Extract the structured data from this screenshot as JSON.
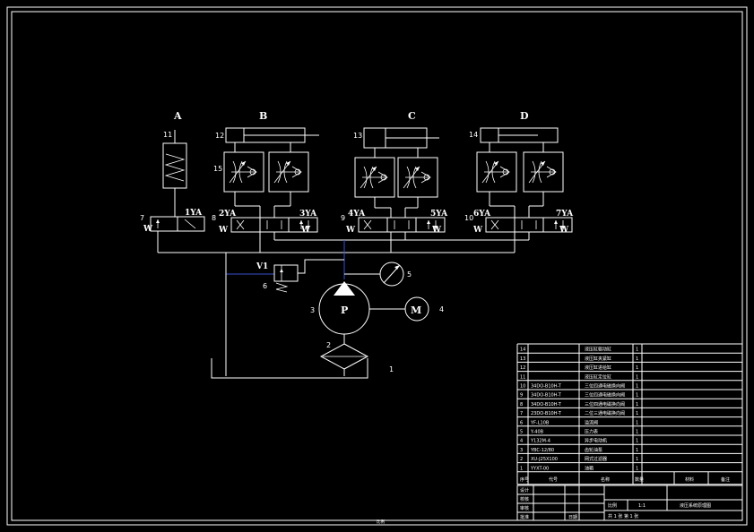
{
  "circuit": {
    "section_labels": [
      "A",
      "B",
      "C",
      "D"
    ],
    "cylinder_labels": [
      "11",
      "12",
      "13",
      "14"
    ],
    "valve_labels": [
      "7",
      "8",
      "9",
      "10"
    ],
    "throttle_label": "15",
    "relief_valve_label": "V1",
    "relief_number": "6",
    "gauge_number": "5",
    "pump_number": "3",
    "pump_symbol": "P",
    "motor_number": "4",
    "motor_symbol": "M",
    "filter_label": "2",
    "tank_label": "1",
    "solenoids": {
      "s1": "1YA",
      "s2": "2YA",
      "s3": "3YA",
      "s4": "4YA",
      "s5": "5YA",
      "s6": "6YA",
      "s7": "7YA"
    },
    "spring_mark": "W"
  },
  "parts_list": {
    "rows": [
      {
        "no": "14",
        "code": "",
        "name": "液压缸驱动缸",
        "qty": "1"
      },
      {
        "no": "13",
        "code": "",
        "name": "液压缸夹紧缸",
        "qty": "1"
      },
      {
        "no": "12",
        "code": "",
        "name": "液压缸进给缸",
        "qty": "1"
      },
      {
        "no": "11",
        "code": "",
        "name": "液压缸定位缸",
        "qty": "1"
      },
      {
        "no": "10",
        "code": "34DO-B10H-T",
        "name": "三位四通电磁换向阀",
        "qty": "1"
      },
      {
        "no": "9",
        "code": "34DO-B10H-T",
        "name": "三位四通电磁换向阀",
        "qty": "1"
      },
      {
        "no": "8",
        "code": "34DO-B10H-T",
        "name": "三位四通电磁换向阀",
        "qty": "1"
      },
      {
        "no": "7",
        "code": "23DO-B10H-T",
        "name": "二位三通电磁换向阀",
        "qty": "1"
      },
      {
        "no": "6",
        "code": "YF-L10B",
        "name": "溢流阀",
        "qty": "1"
      },
      {
        "no": "5",
        "code": "Y-40B",
        "name": "压力表",
        "qty": "1"
      },
      {
        "no": "4",
        "code": "Y132M-4",
        "name": "异步电动机",
        "qty": "1"
      },
      {
        "no": "3",
        "code": "YBC-12/80",
        "name": "齿轮油泵",
        "qty": "1"
      },
      {
        "no": "2",
        "code": "XU-J25X100",
        "name": "网式过滤器",
        "qty": "1"
      },
      {
        "no": "1",
        "code": "YYXT-00",
        "name": "油箱",
        "qty": "1"
      }
    ],
    "headers": [
      "序号",
      "代号",
      "名称",
      "数量",
      "材料",
      "备注"
    ]
  },
  "title_block": {
    "role_labels": [
      "设计",
      "校核",
      "审核",
      "批准"
    ],
    "scale_label": "比例",
    "scale_value": "1:1",
    "drawing_name": "液压系统原理图",
    "sheet_info": "共 1 张  第 1 张",
    "date_label": "日期",
    "bottom_center": "比例"
  }
}
